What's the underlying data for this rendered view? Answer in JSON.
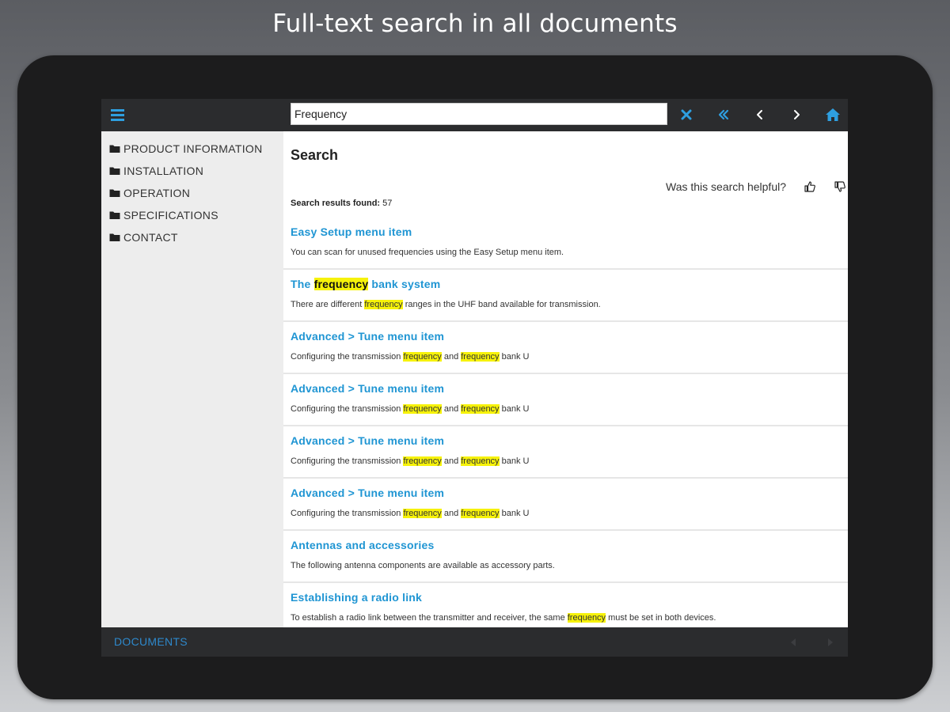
{
  "headline": "Full-text search in all documents",
  "toolbar": {
    "search_value": "Frequency",
    "icons": [
      "menu-icon",
      "close-icon",
      "double-chevron-left-icon",
      "chevron-left-icon",
      "chevron-right-icon",
      "home-icon"
    ]
  },
  "colors": {
    "accent": "#2e9fe0",
    "link": "#1f95d3",
    "highlight": "#f6f20a",
    "bar": "#2b2c2e"
  },
  "sidebar": {
    "items": [
      {
        "label": "PRODUCT INFORMATION"
      },
      {
        "label": "INSTALLATION"
      },
      {
        "label": "OPERATION"
      },
      {
        "label": "SPECIFICATIONS"
      },
      {
        "label": "CONTACT"
      }
    ]
  },
  "main": {
    "title": "Search",
    "helpful_question": "Was this search helpful?",
    "results_found_label": "Search results found:",
    "results_found_count": "57",
    "results": [
      {
        "title": [
          {
            "t": "Easy Setup menu item"
          }
        ],
        "desc": [
          {
            "t": "You can scan for unused frequencies using the Easy Setup menu item."
          }
        ]
      },
      {
        "title": [
          {
            "t": "The "
          },
          {
            "t": "frequency",
            "hl": true
          },
          {
            "t": " bank system"
          }
        ],
        "desc": [
          {
            "t": "There are different "
          },
          {
            "t": "frequency",
            "hl": true
          },
          {
            "t": " ranges in the UHF band available for transmission."
          }
        ]
      },
      {
        "title": [
          {
            "t": "Advanced > Tune menu item"
          }
        ],
        "desc": [
          {
            "t": "Configuring the transmission "
          },
          {
            "t": "frequency",
            "hl": true
          },
          {
            "t": " and "
          },
          {
            "t": "frequency",
            "hl": true
          },
          {
            "t": " bank U"
          }
        ]
      },
      {
        "title": [
          {
            "t": "Advanced > Tune menu item"
          }
        ],
        "desc": [
          {
            "t": "Configuring the transmission "
          },
          {
            "t": "frequency",
            "hl": true
          },
          {
            "t": " and "
          },
          {
            "t": "frequency",
            "hl": true
          },
          {
            "t": " bank U"
          }
        ]
      },
      {
        "title": [
          {
            "t": "Advanced > Tune menu item"
          }
        ],
        "desc": [
          {
            "t": "Configuring the transmission "
          },
          {
            "t": "frequency",
            "hl": true
          },
          {
            "t": " and "
          },
          {
            "t": "frequency",
            "hl": true
          },
          {
            "t": " bank U"
          }
        ]
      },
      {
        "title": [
          {
            "t": "Advanced > Tune menu item"
          }
        ],
        "desc": [
          {
            "t": "Configuring the transmission "
          },
          {
            "t": "frequency",
            "hl": true
          },
          {
            "t": " and "
          },
          {
            "t": "frequency",
            "hl": true
          },
          {
            "t": " bank U"
          }
        ]
      },
      {
        "title": [
          {
            "t": "Antennas and accessories"
          }
        ],
        "desc": [
          {
            "t": "The following antenna components are available as accessory parts."
          }
        ]
      },
      {
        "title": [
          {
            "t": "Establishing a radio link"
          }
        ],
        "desc": [
          {
            "t": "To establish a radio link between the transmitter and receiver, the same "
          },
          {
            "t": "frequency",
            "hl": true
          },
          {
            "t": " must be set in both devices."
          }
        ]
      }
    ]
  },
  "bottombar": {
    "documents_label": "DOCUMENTS"
  }
}
